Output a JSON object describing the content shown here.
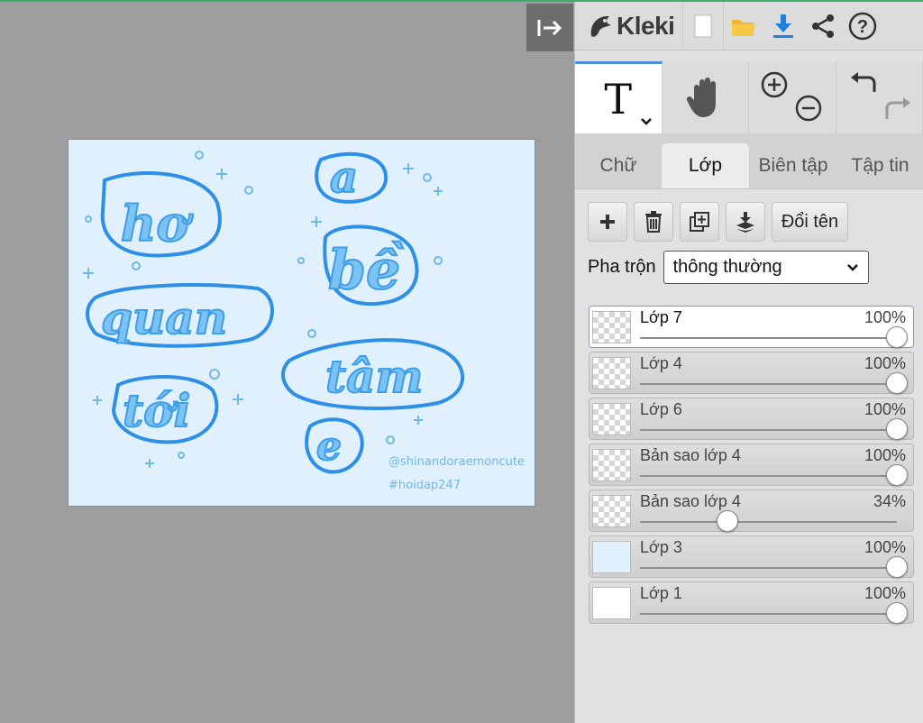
{
  "app": {
    "name": "Kleki"
  },
  "toolbar": {
    "new_icon": "new-file-icon",
    "open_icon": "folder-icon",
    "save_icon": "download-icon",
    "share_icon": "share-icon",
    "help_icon": "help-icon"
  },
  "tools": [
    {
      "name": "text",
      "label": "T",
      "active": true
    },
    {
      "name": "hand",
      "label": ""
    },
    {
      "name": "zoom",
      "label": ""
    },
    {
      "name": "undo-redo",
      "label": ""
    }
  ],
  "tabs": [
    {
      "label": "Chữ",
      "active": false
    },
    {
      "label": "Lớp",
      "active": true
    },
    {
      "label": "Biên tập",
      "active": false
    },
    {
      "label": "Tập tin",
      "active": false
    }
  ],
  "layer_actions": {
    "rename_label": "Đổi tên"
  },
  "blend": {
    "label": "Pha trộn",
    "value": "thông thường"
  },
  "layers": [
    {
      "name": "Lớp 7",
      "opacity": "100%",
      "opacity_value": 1.0,
      "selected": true,
      "thumb": "transparent"
    },
    {
      "name": "Lớp 4",
      "opacity": "100%",
      "opacity_value": 1.0,
      "selected": false,
      "thumb": "transparent"
    },
    {
      "name": "Lớp 6",
      "opacity": "100%",
      "opacity_value": 1.0,
      "selected": false,
      "thumb": "transparent"
    },
    {
      "name": "Bản sao lớp 4",
      "opacity": "100%",
      "opacity_value": 1.0,
      "selected": false,
      "thumb": "transparent"
    },
    {
      "name": "Bản sao lớp 4",
      "opacity": "34%",
      "opacity_value": 0.34,
      "selected": false,
      "thumb": "transparent"
    },
    {
      "name": "Lớp 3",
      "opacity": "100%",
      "opacity_value": 1.0,
      "selected": false,
      "thumb": "blue"
    },
    {
      "name": "Lớp 1",
      "opacity": "100%",
      "opacity_value": 1.0,
      "selected": false,
      "thumb": "white"
    }
  ],
  "canvas": {
    "words": [
      "hơ",
      "a",
      "bề",
      "quan",
      "tâm",
      "tới",
      "e"
    ],
    "credit_line1": "@shinandoraemoncute",
    "credit_line2": "#hoidap247",
    "colors": {
      "background": "#e0f0fc",
      "outline": "#2e8fe6",
      "letters": "#7cc2f3"
    }
  }
}
